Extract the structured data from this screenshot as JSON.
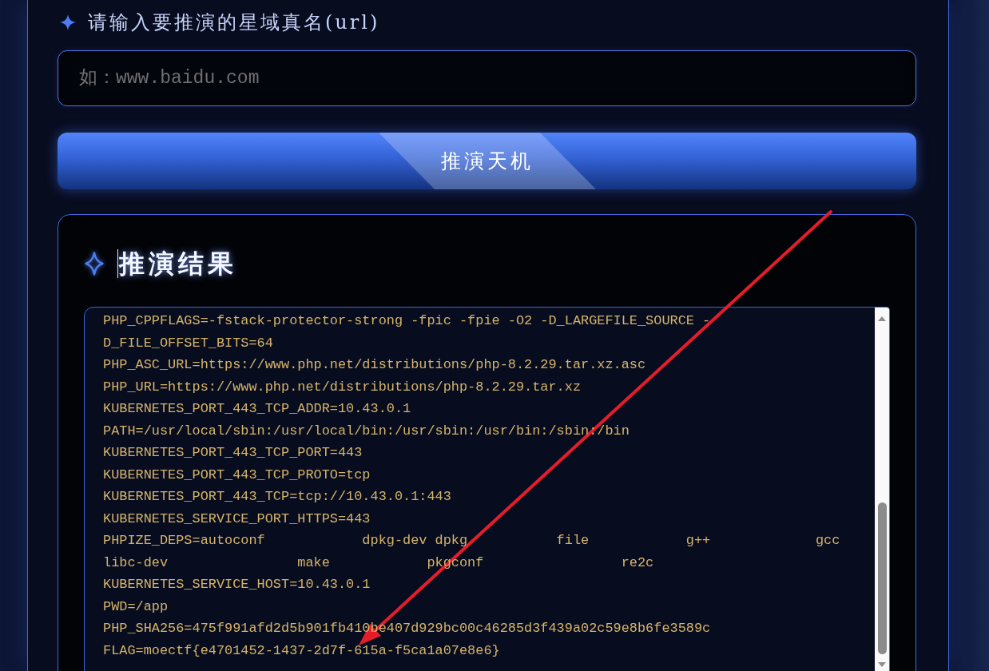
{
  "url_form": {
    "label": "请输入要推演的星域真名(url)",
    "input": {
      "placeholder": "如：www.baidu.com"
    },
    "submit_button": "推演天机"
  },
  "result": {
    "title": "推演结果",
    "output_lines": [
      "PHP_CPPFLAGS=-fstack-protector-strong -fpic -fpie -O2 -D_LARGEFILE_SOURCE -",
      "D_FILE_OFFSET_BITS=64",
      "PHP_ASC_URL=https://www.php.net/distributions/php-8.2.29.tar.xz.asc",
      "PHP_URL=https://www.php.net/distributions/php-8.2.29.tar.xz",
      "KUBERNETES_PORT_443_TCP_ADDR=10.43.0.1",
      "PATH=/usr/local/sbin:/usr/local/bin:/usr/sbin:/usr/bin:/sbin:/bin",
      "KUBERNETES_PORT_443_TCP_PORT=443",
      "KUBERNETES_PORT_443_TCP_PROTO=tcp",
      "KUBERNETES_PORT_443_TCP=tcp://10.43.0.1:443",
      "KUBERNETES_SERVICE_PORT_HTTPS=443",
      "PHPIZE_DEPS=autoconf            dpkg-dev dpkg           file            g++             gcc",
      "libc-dev                make            pkgconf                 re2c",
      "KUBERNETES_SERVICE_HOST=10.43.0.1",
      "PWD=/app",
      "PHP_SHA256=475f991afd2d5b901fb410be407d929bc00c46285d3f439a02c59e8b6fe3589c",
      "FLAG=moectf{e4701452-1437-2d7f-615a-f5ca1a07e8e6}"
    ]
  }
}
